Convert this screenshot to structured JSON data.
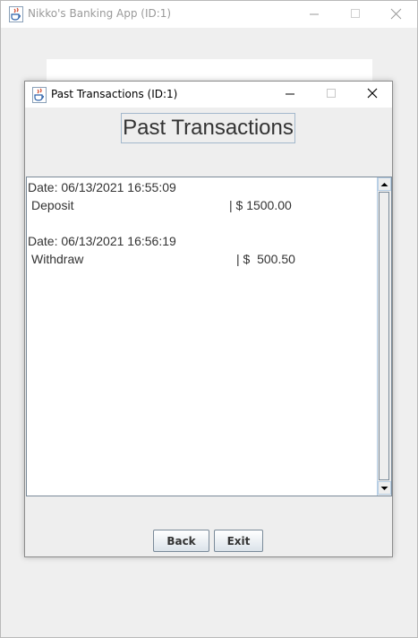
{
  "main_window": {
    "title": "Nikko's Banking App (ID:1)"
  },
  "dialog": {
    "title": "Past Transactions (ID:1)",
    "heading": "Past Transactions",
    "transactions": [
      {
        "date_line": "Date: 06/13/2021 16:55:09",
        "type": "Deposit",
        "amount": "| $ 1500.00"
      },
      {
        "date_line": "Date: 06/13/2021 16:56:19",
        "type": "Withdraw",
        "amount": "| $  500.50"
      }
    ],
    "buttons": {
      "back": "Back",
      "exit": "Exit"
    }
  },
  "icons": {
    "app": "java-coffee-cup-icon",
    "minimize": "minimize-icon",
    "maximize": "maximize-icon",
    "close": "close-icon",
    "scroll_up": "arrow-up-icon",
    "scroll_down": "arrow-down-icon"
  }
}
